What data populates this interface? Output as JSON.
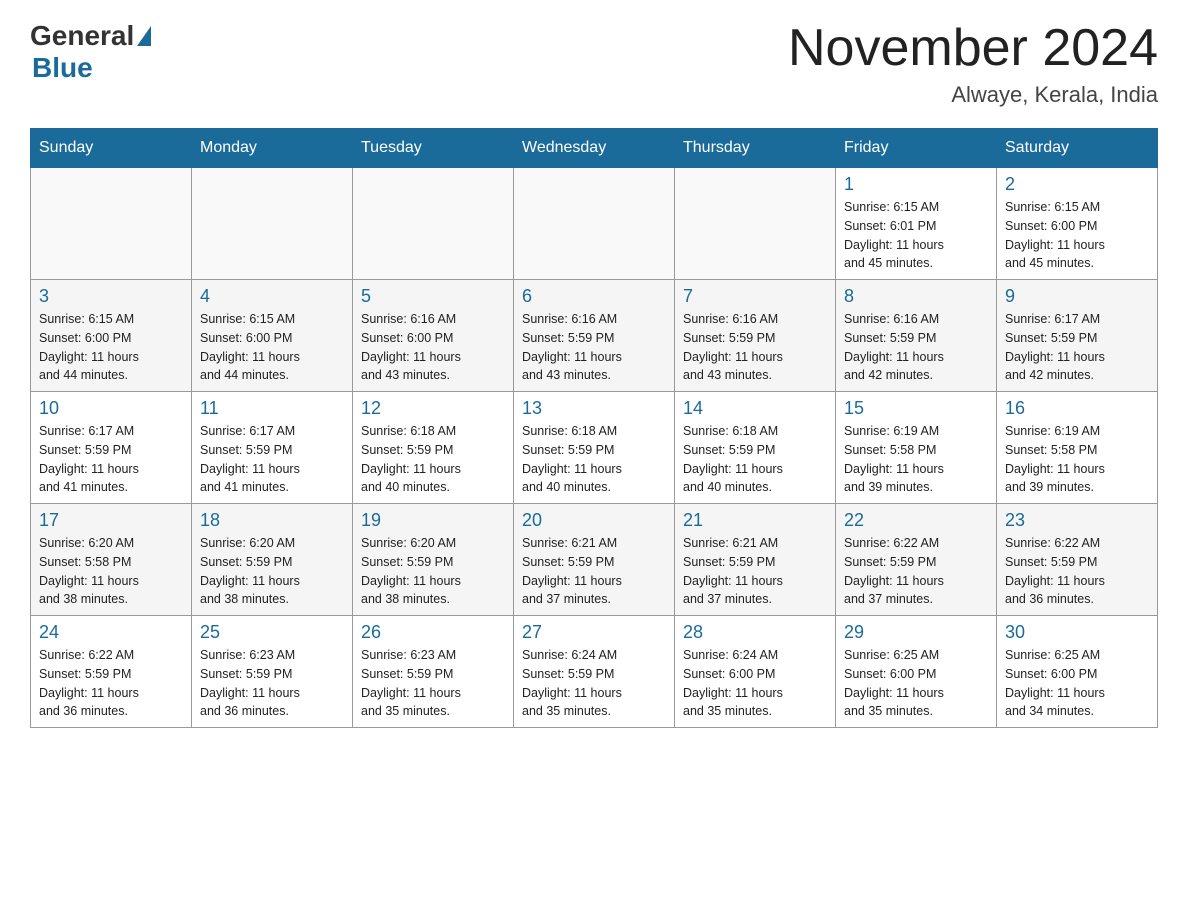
{
  "header": {
    "logo_general": "General",
    "logo_blue": "Blue",
    "title": "November 2024",
    "location": "Alwaye, Kerala, India"
  },
  "days_of_week": [
    "Sunday",
    "Monday",
    "Tuesday",
    "Wednesday",
    "Thursday",
    "Friday",
    "Saturday"
  ],
  "weeks": [
    {
      "days": [
        {
          "number": "",
          "info": ""
        },
        {
          "number": "",
          "info": ""
        },
        {
          "number": "",
          "info": ""
        },
        {
          "number": "",
          "info": ""
        },
        {
          "number": "",
          "info": ""
        },
        {
          "number": "1",
          "info": "Sunrise: 6:15 AM\nSunset: 6:01 PM\nDaylight: 11 hours\nand 45 minutes."
        },
        {
          "number": "2",
          "info": "Sunrise: 6:15 AM\nSunset: 6:00 PM\nDaylight: 11 hours\nand 45 minutes."
        }
      ]
    },
    {
      "days": [
        {
          "number": "3",
          "info": "Sunrise: 6:15 AM\nSunset: 6:00 PM\nDaylight: 11 hours\nand 44 minutes."
        },
        {
          "number": "4",
          "info": "Sunrise: 6:15 AM\nSunset: 6:00 PM\nDaylight: 11 hours\nand 44 minutes."
        },
        {
          "number": "5",
          "info": "Sunrise: 6:16 AM\nSunset: 6:00 PM\nDaylight: 11 hours\nand 43 minutes."
        },
        {
          "number": "6",
          "info": "Sunrise: 6:16 AM\nSunset: 5:59 PM\nDaylight: 11 hours\nand 43 minutes."
        },
        {
          "number": "7",
          "info": "Sunrise: 6:16 AM\nSunset: 5:59 PM\nDaylight: 11 hours\nand 43 minutes."
        },
        {
          "number": "8",
          "info": "Sunrise: 6:16 AM\nSunset: 5:59 PM\nDaylight: 11 hours\nand 42 minutes."
        },
        {
          "number": "9",
          "info": "Sunrise: 6:17 AM\nSunset: 5:59 PM\nDaylight: 11 hours\nand 42 minutes."
        }
      ]
    },
    {
      "days": [
        {
          "number": "10",
          "info": "Sunrise: 6:17 AM\nSunset: 5:59 PM\nDaylight: 11 hours\nand 41 minutes."
        },
        {
          "number": "11",
          "info": "Sunrise: 6:17 AM\nSunset: 5:59 PM\nDaylight: 11 hours\nand 41 minutes."
        },
        {
          "number": "12",
          "info": "Sunrise: 6:18 AM\nSunset: 5:59 PM\nDaylight: 11 hours\nand 40 minutes."
        },
        {
          "number": "13",
          "info": "Sunrise: 6:18 AM\nSunset: 5:59 PM\nDaylight: 11 hours\nand 40 minutes."
        },
        {
          "number": "14",
          "info": "Sunrise: 6:18 AM\nSunset: 5:59 PM\nDaylight: 11 hours\nand 40 minutes."
        },
        {
          "number": "15",
          "info": "Sunrise: 6:19 AM\nSunset: 5:58 PM\nDaylight: 11 hours\nand 39 minutes."
        },
        {
          "number": "16",
          "info": "Sunrise: 6:19 AM\nSunset: 5:58 PM\nDaylight: 11 hours\nand 39 minutes."
        }
      ]
    },
    {
      "days": [
        {
          "number": "17",
          "info": "Sunrise: 6:20 AM\nSunset: 5:58 PM\nDaylight: 11 hours\nand 38 minutes."
        },
        {
          "number": "18",
          "info": "Sunrise: 6:20 AM\nSunset: 5:59 PM\nDaylight: 11 hours\nand 38 minutes."
        },
        {
          "number": "19",
          "info": "Sunrise: 6:20 AM\nSunset: 5:59 PM\nDaylight: 11 hours\nand 38 minutes."
        },
        {
          "number": "20",
          "info": "Sunrise: 6:21 AM\nSunset: 5:59 PM\nDaylight: 11 hours\nand 37 minutes."
        },
        {
          "number": "21",
          "info": "Sunrise: 6:21 AM\nSunset: 5:59 PM\nDaylight: 11 hours\nand 37 minutes."
        },
        {
          "number": "22",
          "info": "Sunrise: 6:22 AM\nSunset: 5:59 PM\nDaylight: 11 hours\nand 37 minutes."
        },
        {
          "number": "23",
          "info": "Sunrise: 6:22 AM\nSunset: 5:59 PM\nDaylight: 11 hours\nand 36 minutes."
        }
      ]
    },
    {
      "days": [
        {
          "number": "24",
          "info": "Sunrise: 6:22 AM\nSunset: 5:59 PM\nDaylight: 11 hours\nand 36 minutes."
        },
        {
          "number": "25",
          "info": "Sunrise: 6:23 AM\nSunset: 5:59 PM\nDaylight: 11 hours\nand 36 minutes."
        },
        {
          "number": "26",
          "info": "Sunrise: 6:23 AM\nSunset: 5:59 PM\nDaylight: 11 hours\nand 35 minutes."
        },
        {
          "number": "27",
          "info": "Sunrise: 6:24 AM\nSunset: 5:59 PM\nDaylight: 11 hours\nand 35 minutes."
        },
        {
          "number": "28",
          "info": "Sunrise: 6:24 AM\nSunset: 6:00 PM\nDaylight: 11 hours\nand 35 minutes."
        },
        {
          "number": "29",
          "info": "Sunrise: 6:25 AM\nSunset: 6:00 PM\nDaylight: 11 hours\nand 35 minutes."
        },
        {
          "number": "30",
          "info": "Sunrise: 6:25 AM\nSunset: 6:00 PM\nDaylight: 11 hours\nand 34 minutes."
        }
      ]
    }
  ]
}
